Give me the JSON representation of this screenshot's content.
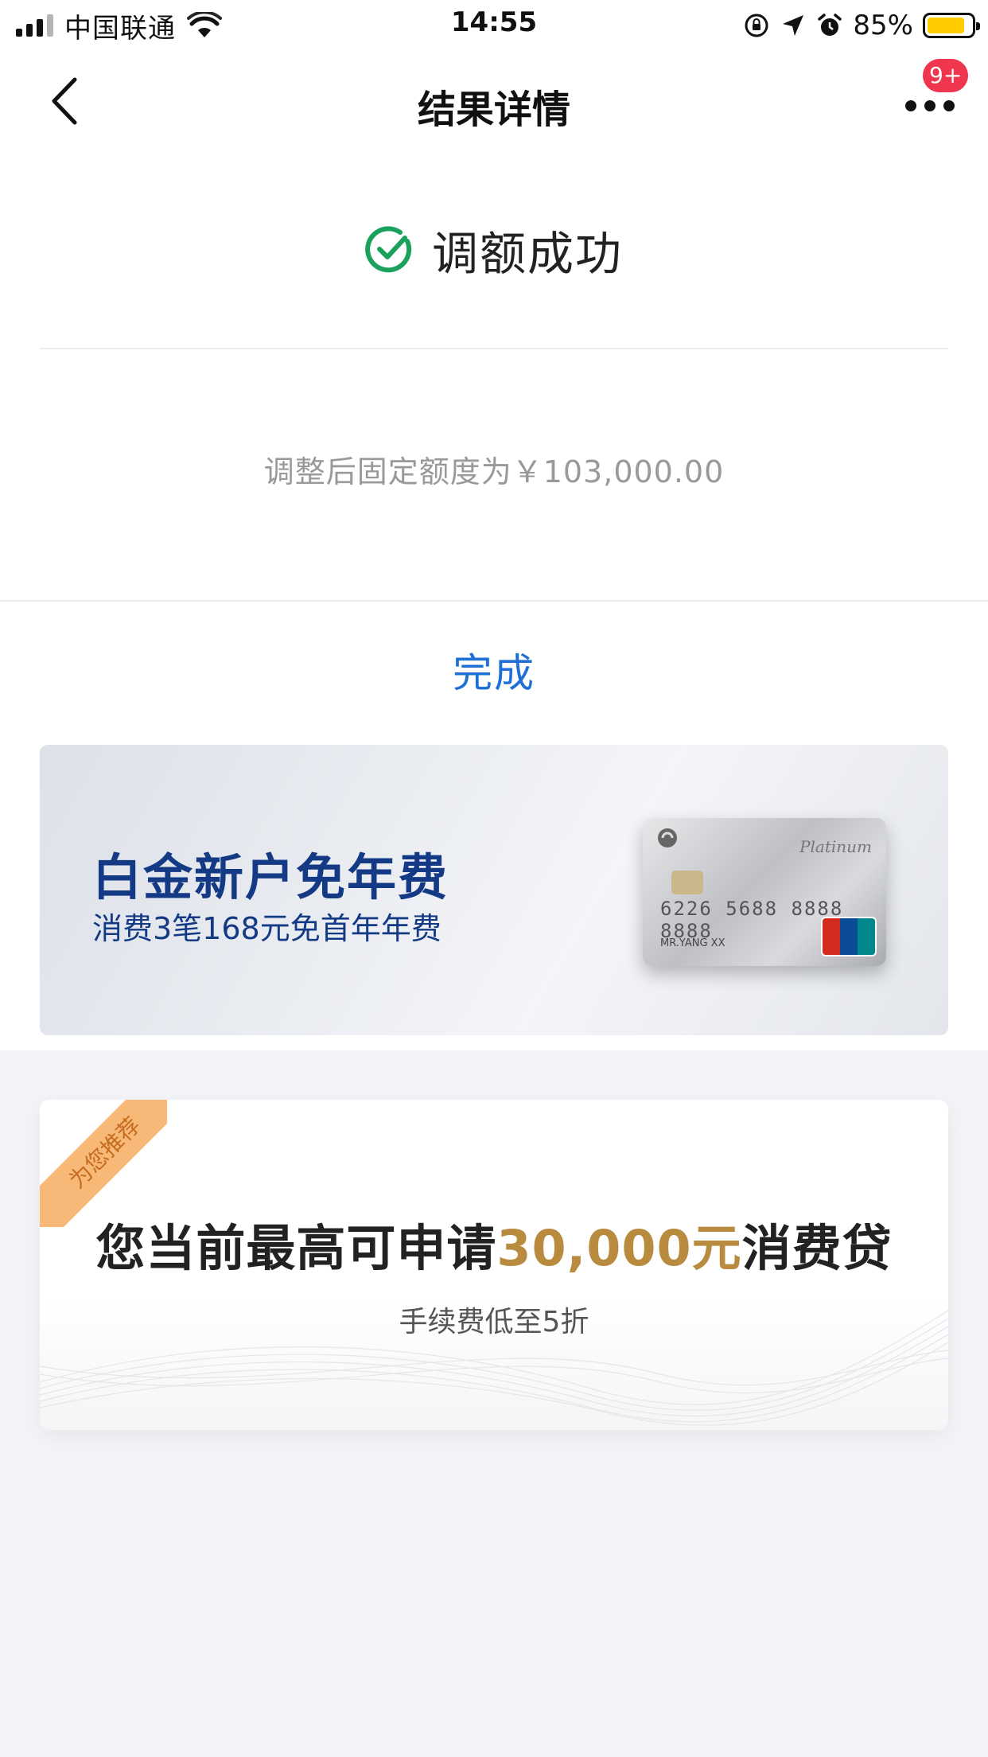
{
  "status_bar": {
    "carrier": "中国联通",
    "time": "14:55",
    "battery_percent": "85%",
    "battery_level": 0.85,
    "battery_color": "#ffcc00"
  },
  "nav": {
    "title": "结果详情",
    "badge": "9+"
  },
  "result": {
    "title": "调额成功",
    "limit_text": "调整后固定额度为￥103,000.00",
    "done_label": "完成",
    "success_color": "#1aa15b",
    "link_color": "#1e6fd6"
  },
  "banner": {
    "title": "白金新户免年费",
    "subtitle": "消费3笔168元免首年年费",
    "card_platinum": "Platinum",
    "card_number": "6226 5688 8888 8888",
    "card_holder": "MR.YANG XX",
    "card_unionpay": "UnionPay 银联"
  },
  "recommendation": {
    "ribbon": "为您推荐",
    "title_prefix": "您当前最高可申请",
    "title_amount": "30,000元",
    "title_suffix": "消费贷",
    "subtitle": "手续费低至5折",
    "accent_color": "#b88b3e"
  }
}
